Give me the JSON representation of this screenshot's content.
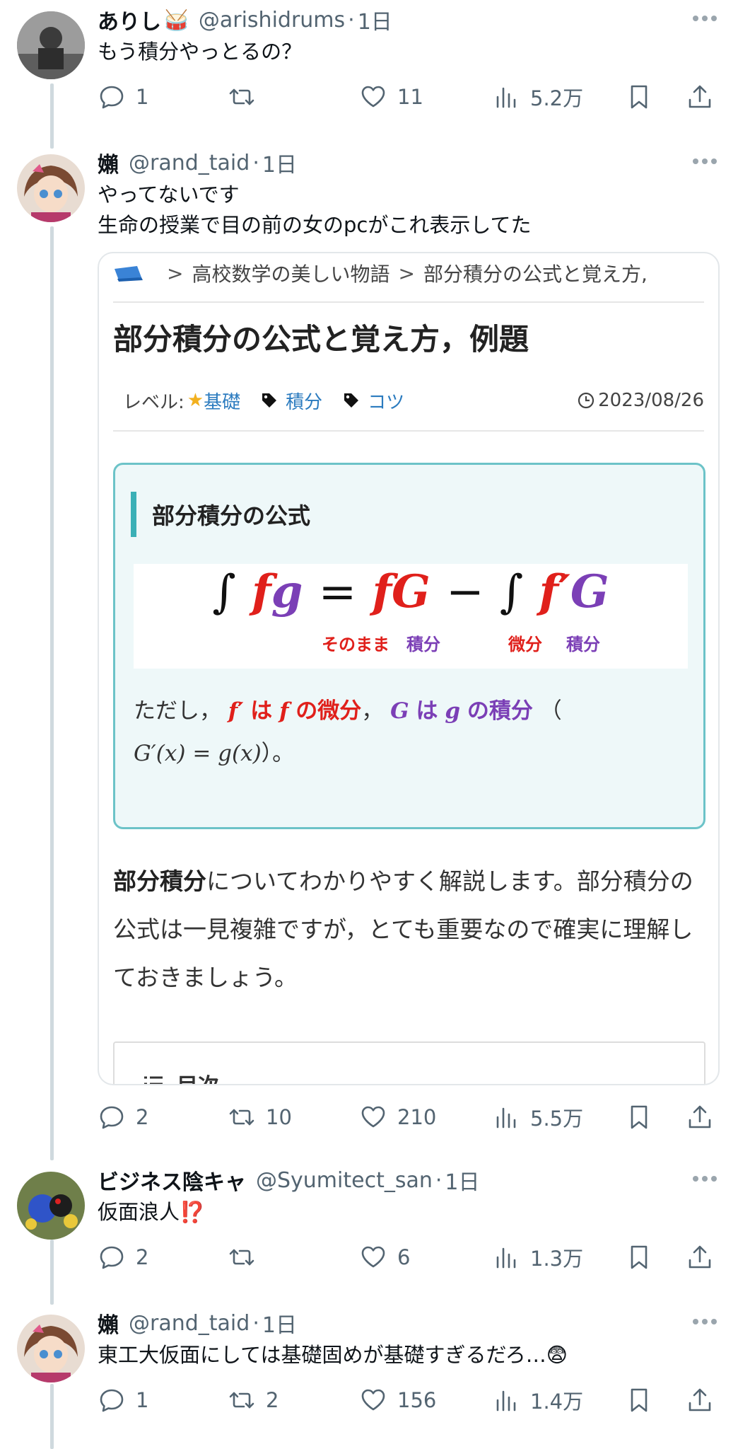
{
  "posts": [
    {
      "name": "ありし",
      "emoji": "🥁",
      "handle": "@arishidrums",
      "time": "1日",
      "text": [
        "もう積分やっとるの？"
      ],
      "replies": "1",
      "reposts": "",
      "likes": "11",
      "views": "5.2万"
    },
    {
      "name": "嬾",
      "emoji": "",
      "handle": "@rand_taid",
      "time": "1日",
      "text": [
        "やってないです",
        "生命の授業で目の前の女のpcがこれ表示してた"
      ],
      "replies": "2",
      "reposts": "10",
      "likes": "210",
      "views": "5.5万"
    },
    {
      "name": "ビジネス陰キャ",
      "emoji": "",
      "handle": "@Syumitect_san",
      "time": "1日",
      "text": [
        "仮面浪人⁉️"
      ],
      "replies": "2",
      "reposts": "",
      "likes": "6",
      "views": "1.3万"
    },
    {
      "name": "嬾",
      "emoji": "",
      "handle": "@rand_taid",
      "time": "1日",
      "text": [
        "東工大仮面にしては基礎固めが基礎すぎるだろ…😨"
      ],
      "replies": "1",
      "reposts": "2",
      "likes": "156",
      "views": "1.4万"
    }
  ],
  "card": {
    "breadcrumb": [
      ">",
      "高校数学の美しい物語",
      ">",
      "部分積分の公式と覚え方,"
    ],
    "title": "部分積分の公式と覚え方，例題",
    "level_label": "レベル:",
    "level_value": "基礎",
    "tags": [
      "積分",
      "コツ"
    ],
    "date": "2023/08/26",
    "box_title": "部分積分の公式",
    "formula": {
      "integral": "∫",
      "f": "f",
      "g": "g",
      "eq": "=",
      "fG": "fG",
      "minus": "−",
      "fprime": "f′",
      "G": "G"
    },
    "notes": {
      "sonomama": "そのまま",
      "sekibun1": "積分",
      "bibun": "微分",
      "sekibun2": "積分"
    },
    "where": {
      "prefix": "ただし，",
      "fprime": "f′",
      "wa1": "は",
      "f": "f",
      "no_bibun": "の微分",
      "comma": "，",
      "G": "G",
      "wa2": "は",
      "g": "g",
      "no_sekibun": "の積分",
      "paren_open": "（",
      "relation": "G′(x) = g(x)",
      "paren_close": "）。"
    },
    "intro_bold": "部分積分",
    "intro_rest": "についてわかりやすく解説します。部分積分の公式は一見複雑ですが，とても重要なので確実に理解しておきましょう。",
    "toc_label": "目次"
  }
}
